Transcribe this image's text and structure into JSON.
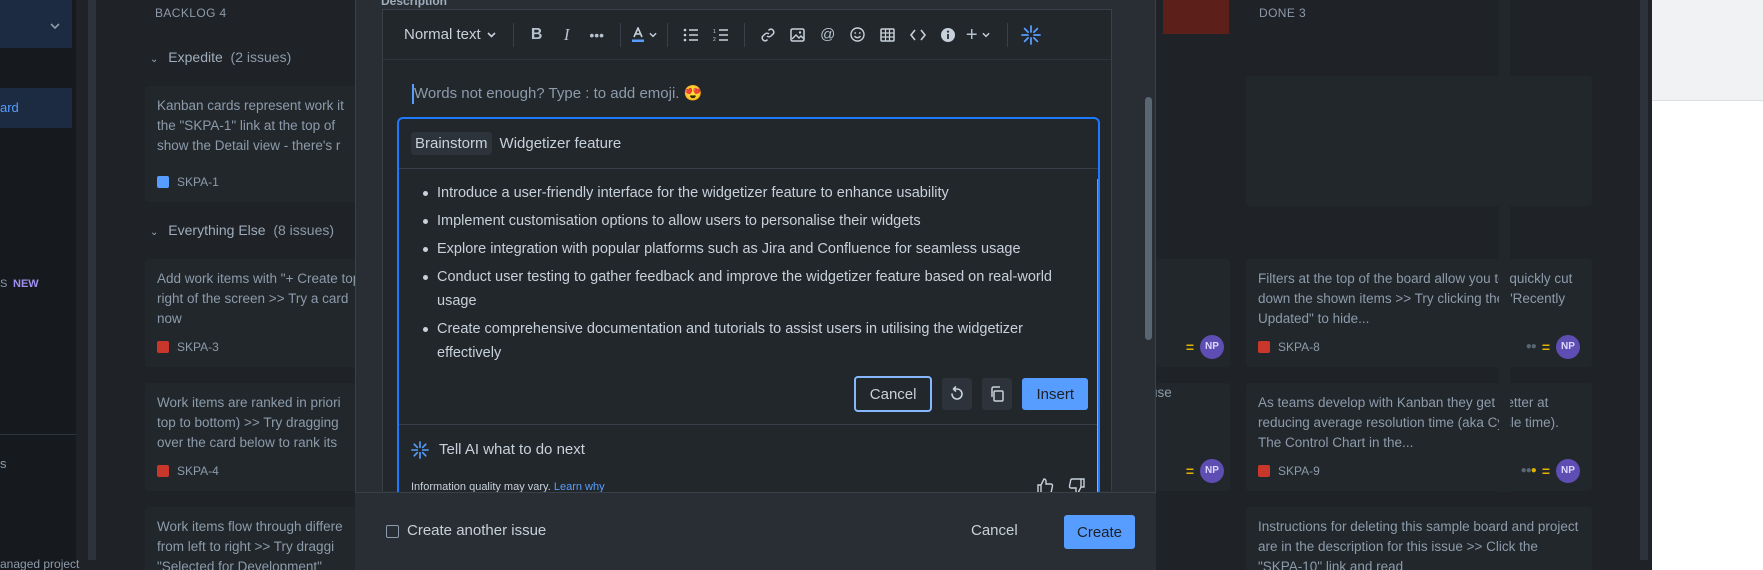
{
  "background": {
    "nav": {
      "item_text": "ard",
      "new_prefix": "S",
      "new_badge": "NEW",
      "bottom_text": "s",
      "footer_text": "anaged project"
    },
    "columns": [
      {
        "title": "BACKLOG 4"
      },
      {
        "title": "DONE 3"
      }
    ],
    "groups": [
      {
        "name": "Expedite",
        "count": "(2 issues)"
      },
      {
        "name": "Everything Else",
        "count": "(8 issues)"
      }
    ],
    "backlog_cards": [
      {
        "text": "Kanban cards represent work it the \"SKPA-1\" link at the top of show the Detail view - there's r",
        "key": "SKPA-1"
      },
      {
        "text": "Add work items with \"+ Create top right of the screen >> Try a card now",
        "key": "SKPA-3"
      },
      {
        "text": "Work items are ranked in priori top to bottom) >> Try dragging over the card below to rank its",
        "key": "SKPA-4"
      },
      {
        "text": "Work items flow through differe from left to right >> Try draggi \"Selected for Development\"",
        "key": ""
      }
    ],
    "middle_card_fragment": "use",
    "done_cards": [
      {
        "text": "Filters at the top of the board allow you to quickly cut down the shown items >> Try clicking the \"Recently Updated\" to hide...",
        "key": "SKPA-8",
        "avatar": "NP"
      },
      {
        "text": "As teams develop with Kanban they get better at reducing average resolution time (aka Cycle time). The Control Chart in the...",
        "key": "SKPA-9",
        "avatar": "NP"
      },
      {
        "text": "Instructions for deleting this sample board and project are in the description for this issue >> Click the \"SKPA-10\" link and read",
        "key": ""
      }
    ],
    "middle_avatars": [
      "NP",
      "NP"
    ]
  },
  "modal": {
    "description_label": "Description",
    "toolbar": {
      "text_style": "Normal text"
    },
    "editor_placeholder": "Words not enough? Type : to add emoji. 😍",
    "ai": {
      "chip": "Brainstorm",
      "prompt": "Widgetizer feature",
      "items": [
        "Introduce a user-friendly interface for the widgetizer feature to enhance usability",
        "Implement customisation options to allow users to personalise their widgets",
        "Explore integration with popular platforms such as Jira and Confluence for seamless usage",
        "Conduct user testing to gather feedback and improve the widgetizer feature based on real-world usage",
        "Create comprehensive documentation and tutorials to assist users in utilising the widgetizer effectively"
      ],
      "cancel_label": "Cancel",
      "insert_label": "Insert",
      "next_placeholder": "Tell AI what to do next",
      "disclaimer": "Information quality may vary.",
      "learn_why": "Learn why"
    },
    "footer": {
      "create_another_label": "Create another issue",
      "cancel_label": "Cancel",
      "create_label": "Create"
    }
  },
  "colors": {
    "accent": "#579dff",
    "surface": "#282e33",
    "backdrop": "#1f2226"
  }
}
